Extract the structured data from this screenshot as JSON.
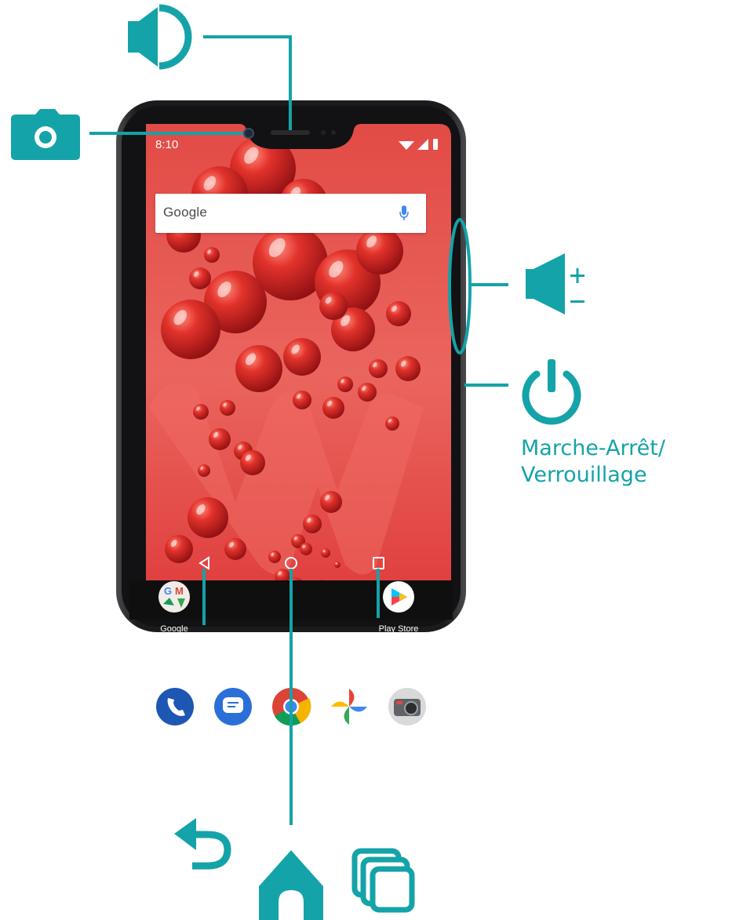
{
  "accent_color": "#14a3a8",
  "screen_color": "#e0403f",
  "status_bar": {
    "time": "8:10"
  },
  "search": {
    "logo_text": "Google",
    "mic_icon": "mic-icon"
  },
  "apps": {
    "google": {
      "label": "Google",
      "icon": "google-folder-icon"
    },
    "play_store": {
      "label": "Play Store",
      "icon": "play-store-icon"
    }
  },
  "dock": [
    "phone-icon",
    "messages-icon",
    "chrome-icon",
    "photos-icon",
    "camera-app-icon"
  ],
  "nav_bar": [
    "back-button",
    "home-button",
    "recents-button"
  ],
  "callouts": {
    "speaker": {
      "icon": "speaker-icon"
    },
    "camera": {
      "icon": "camera-icon"
    },
    "volume": {
      "icon": "volume-plus-minus-icon"
    },
    "power": {
      "icon": "power-icon",
      "label_line1": "Marche-Arrêt/",
      "label_line2": "Verrouillage"
    },
    "back": {
      "icon": "back-arrow-icon"
    },
    "home": {
      "icon": "home-icon"
    },
    "recents": {
      "icon": "recents-icon"
    }
  }
}
